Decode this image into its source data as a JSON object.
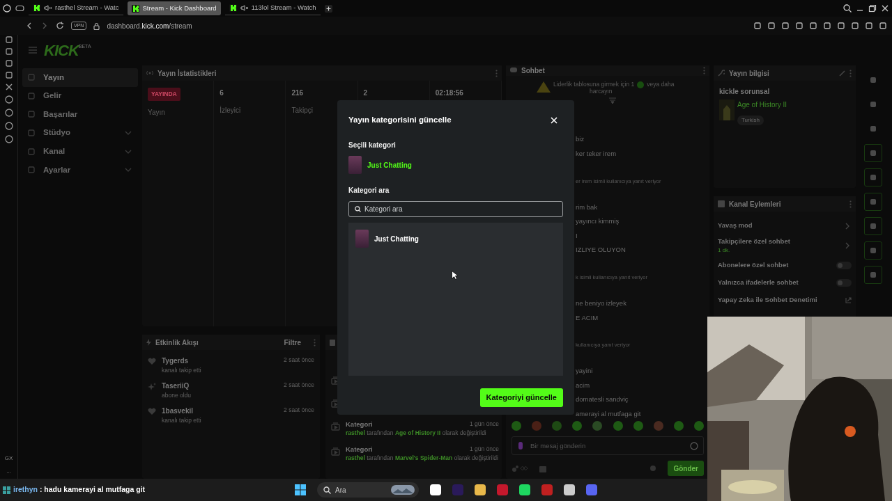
{
  "browser": {
    "tabs": [
      {
        "title": "rasthel Stream - Watc",
        "muted": true,
        "selected": false
      },
      {
        "title": "Stream - Kick Dashboard",
        "muted": false,
        "selected": true
      },
      {
        "title": "113lol Stream - Watch",
        "muted": true,
        "selected": false
      }
    ],
    "vpn": "VPN",
    "url": {
      "host": "dashboard.",
      "domain": "kick.com",
      "path": "/stream"
    },
    "sidebar_labels": [
      "GX",
      "..."
    ]
  },
  "logo": {
    "text": "KICK",
    "badge": "BETA"
  },
  "nav": [
    {
      "label": "Yayın",
      "selected": true,
      "expandable": false
    },
    {
      "label": "Gelir",
      "selected": false,
      "expandable": false
    },
    {
      "label": "Başarılar",
      "selected": false,
      "expandable": false
    },
    {
      "label": "Stüdyo",
      "selected": false,
      "expandable": true
    },
    {
      "label": "Kanal",
      "selected": false,
      "expandable": true
    },
    {
      "label": "Ayarlar",
      "selected": false,
      "expandable": true
    }
  ],
  "stats": {
    "title": "Yayın İstatistikleri",
    "status": "YAYINDA",
    "status_label": "Yayın",
    "items": [
      {
        "value": "6",
        "label": "İzleyici"
      },
      {
        "value": "216",
        "label": "Takipçi"
      },
      {
        "value": "2"
      },
      {
        "value": "02:18:56"
      }
    ]
  },
  "activity": {
    "title": "Etkinlik Akışı",
    "filter": "Filtre",
    "items": [
      {
        "kind": "follow",
        "user": "Tygerds",
        "action": "kanalı takip etti",
        "time": "2 saat önce"
      },
      {
        "kind": "subscribe",
        "user": "TaseriiQ",
        "action": "abone oldu",
        "time": "2 saat önce"
      },
      {
        "kind": "follow",
        "user": "1basvekil",
        "action": "kanalı takip etti",
        "time": "2 saat önce"
      }
    ]
  },
  "log": {
    "items": [
      {
        "kind": "hidden"
      },
      {
        "kind": "hidden"
      },
      {
        "kind": "change",
        "title": "Kategori",
        "time": "1 gün önce",
        "user": "rasthel",
        "middle": "tarafından",
        "game": "Age of History II",
        "end": "olarak değiştirildi"
      },
      {
        "kind": "change",
        "title": "Kategori",
        "time": "1 gün önce",
        "user": "rasthel",
        "middle": "tarafından",
        "game": "Marvel's Spider-Man",
        "end": "olarak değiştirildi"
      }
    ]
  },
  "chat": {
    "title": "Sohbet",
    "notice": "Liderlik tablosuna girmek için 1",
    "notice_end": "veya daha",
    "notice_line2": "harcayın",
    "messages": [
      {
        "kind": "message",
        "text": "biz"
      },
      {
        "kind": "message",
        "text": "ker teker irem"
      },
      {
        "kind": "reply",
        "text": "er irem isimli kullanıcıya yanıt veriyor"
      },
      {
        "kind": "message",
        "text": "rim bak"
      },
      {
        "kind": "message",
        "text": "yayıncı kimmiş"
      },
      {
        "kind": "message",
        "text": "I"
      },
      {
        "kind": "message",
        "text": "IZLIYE OLUYON"
      },
      {
        "kind": "reply",
        "text": "k isimli kullanıcıya yanıt veriyor"
      },
      {
        "kind": "message",
        "text": "ne beniyo izleyek"
      },
      {
        "kind": "message",
        "text": "E ACIM"
      },
      {
        "kind": "reply",
        "text": "kullanıcıya yanıt veriyor"
      },
      {
        "kind": "message",
        "text": "yayini"
      },
      {
        "kind": "message",
        "text": "acim"
      },
      {
        "kind": "message",
        "text": "domatesli sandviç"
      },
      {
        "kind": "message",
        "text": "amerayi al mutfaga git"
      }
    ],
    "input": {
      "placeholder": "Bir mesaj gönderin"
    },
    "send": "Gönder"
  },
  "stream_info": {
    "title": "Yayın bilgisi",
    "stream_title": "kickle sorunsal",
    "game": "Age of History II",
    "tag": "Turkish"
  },
  "channel_actions": {
    "title": "Kanal Eylemleri",
    "items": [
      {
        "kind": "link",
        "label": "Yavaş mod"
      },
      {
        "kind": "link",
        "label": "Takipçilere özel sohbet",
        "sub": "1 dk."
      },
      {
        "kind": "toggle",
        "label": "Abonelere özel sohbet",
        "on": false
      },
      {
        "kind": "toggle",
        "label": "Yalnızca ifadelerle sohbet",
        "on": false
      },
      {
        "kind": "external",
        "label": "Yapay Zeka ile Sohbet Denetimi"
      }
    ]
  },
  "modal": {
    "title": "Yayın kategorisini güncelle",
    "selected_label": "Seçili kategori",
    "selected": "Just Chatting",
    "search_label": "Kategori ara",
    "search": {
      "placeholder": "Kategori ara"
    },
    "results": [
      {
        "name": "Just Chatting"
      }
    ],
    "button": "Kategoriyi güncelle"
  },
  "overlay": {
    "user": "irethyn",
    "message": ": hadu kamerayi al mutfaga git"
  },
  "taskbar": {
    "search": {
      "placeholder": "Ara"
    }
  }
}
